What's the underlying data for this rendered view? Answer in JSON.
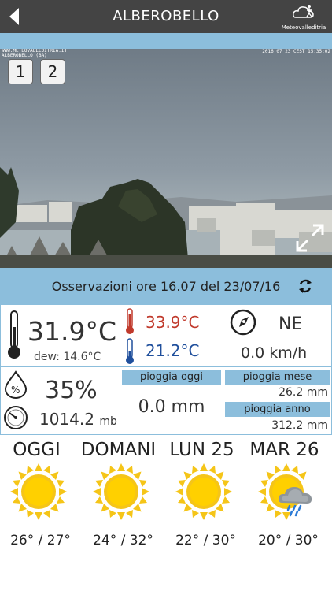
{
  "header": {
    "title": "ALBEROBELLO",
    "logo_text": "Meteovalleditria"
  },
  "webcam": {
    "overlay_left_line1": "WWW.METEOVALLEDITRIA.IT",
    "overlay_left_line2": "ALBEROBELLO (BA)",
    "overlay_right": "2016 07 23 CEST 15:35:02",
    "buttons": [
      "1",
      "2"
    ]
  },
  "observation": {
    "text": "Osservazioni ore 16.07 del 23/07/16"
  },
  "current": {
    "temperature": "31.9°C",
    "dew": "dew: 14.6°C",
    "temp_max": "33.9°C",
    "temp_min": "21.2°C",
    "wind_dir": "NE",
    "wind_speed": "0.0 km/h",
    "humidity": "35%",
    "pressure_value": "1014.2",
    "pressure_unit": "mb",
    "rain_today_label": "pioggia oggi",
    "rain_today": "0.0 mm",
    "rain_month_label": "pioggia mese",
    "rain_month": "26.2 mm",
    "rain_year_label": "pioggia anno",
    "rain_year": "312.2 mm"
  },
  "colors": {
    "accent": "#8cbedc",
    "header": "#444444",
    "temp_max": "#c0392b",
    "temp_min": "#1f4f9c",
    "sun": "#f5c518"
  },
  "forecast": [
    {
      "day": "OGGI",
      "temps": "26° / 27°",
      "icon": "sun-icon"
    },
    {
      "day": "DOMANI",
      "temps": "24° / 32°",
      "icon": "sun-icon"
    },
    {
      "day": "LUN 25",
      "temps": "22° / 30°",
      "icon": "sun-icon"
    },
    {
      "day": "MAR 26",
      "temps": "20° / 30°",
      "icon": "sun-rain-cloud-icon"
    }
  ]
}
